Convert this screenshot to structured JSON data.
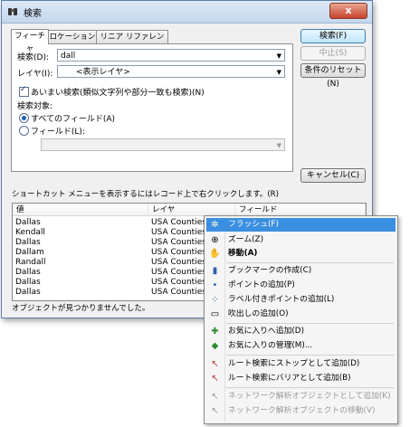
{
  "window": {
    "title": "検索",
    "close_label": "x"
  },
  "tabs": [
    "フィーチャ",
    "ロケーション",
    "リニア リファレンス"
  ],
  "form": {
    "search_label": "検索(D):",
    "search_value": "dall",
    "layer_label": "レイヤ(I):",
    "layer_value": "<表示レイヤ>",
    "fuzzy_label": "あいまい検索(類似文字列や部分一致も検索)(N)",
    "fuzzy_checked": true,
    "target_label": "検索対象:",
    "all_fields_label": "すべてのフィールド(A)",
    "field_label": "フィールド(L):"
  },
  "buttons": {
    "search": "検索(F)",
    "stop": "中止(S)",
    "reset": "条件のリセット(N)",
    "cancel": "キャンセル(C)"
  },
  "hint": "ショートカット メニューを表示するにはレコード上で右クリックします。(R)",
  "table": {
    "columns": [
      "値",
      "レイヤ",
      "フィールド"
    ],
    "rows": [
      [
        "Dallas",
        "USA Counties",
        ""
      ],
      [
        "Kendall",
        "USA Counties",
        ""
      ],
      [
        "Dallas",
        "USA Counties",
        ""
      ],
      [
        "Dallam",
        "USA Counties",
        ""
      ],
      [
        "Randall",
        "USA Counties",
        ""
      ],
      [
        "Dallas",
        "USA Counties",
        ""
      ],
      [
        "Dallas",
        "USA Counties",
        ""
      ],
      [
        "Dallas",
        "USA Counties",
        ""
      ]
    ]
  },
  "status": "オブジェクトが見つかりませんでした。",
  "context_menu": {
    "items": [
      {
        "label": "フラッシュ(F)",
        "icon": "flash-icon"
      },
      {
        "label": "ズーム(Z)",
        "icon": "zoom-icon"
      },
      {
        "label": "移動(A)",
        "icon": "pan-icon"
      },
      {
        "label": "ブックマークの作成(C)",
        "icon": "bookmark-icon"
      },
      {
        "label": "ポイントの追加(P)",
        "icon": "point-icon"
      },
      {
        "label": "ラベル付きポイントの追加(L)",
        "icon": "labeled-point-icon"
      },
      {
        "label": "吹出しの追加(O)",
        "icon": "callout-icon"
      },
      {
        "label": "お気に入りへ追加(D)",
        "icon": "favorite-add-icon"
      },
      {
        "label": "お気に入りの管理(M)...",
        "icon": "favorite-manage-icon"
      },
      {
        "label": "ルート検索にストップとして追加(D)",
        "icon": "route-stop-icon"
      },
      {
        "label": "ルート検索にバリアとして追加(B)",
        "icon": "route-barrier-icon"
      },
      {
        "label": "ネットワーク解析オブジェクトとして追加(K)",
        "icon": "network-add-icon"
      },
      {
        "label": "ネットワーク解析オブジェクトの移動(V)",
        "icon": "network-move-icon"
      }
    ]
  }
}
